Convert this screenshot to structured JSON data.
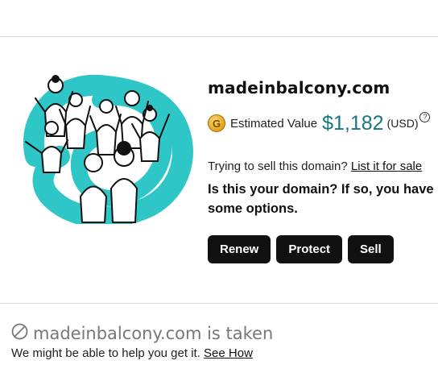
{
  "domain": {
    "name": "madeinbalcony.com"
  },
  "valuation": {
    "coin_letter": "G",
    "label": "Estimated Value",
    "amount": "$1,182",
    "currency": "(USD)",
    "help_icon": "?",
    "amount_color": "#16787a"
  },
  "sell_prompt": {
    "text": "Trying to sell this domain?",
    "link": "List it for sale"
  },
  "ownership_prompt": "Is this your domain? If so, you have some options.",
  "actions": [
    {
      "label": "Renew"
    },
    {
      "label": "Protect"
    },
    {
      "label": "Sell"
    }
  ],
  "taken": {
    "icon": "prohibited-icon",
    "title": "madeinbalcony.com is taken",
    "help_text": "We might be able to help you get it.",
    "help_link": "See How"
  },
  "colors": {
    "brand_teal": "#2ec6c6",
    "button_bg": "#111111"
  }
}
